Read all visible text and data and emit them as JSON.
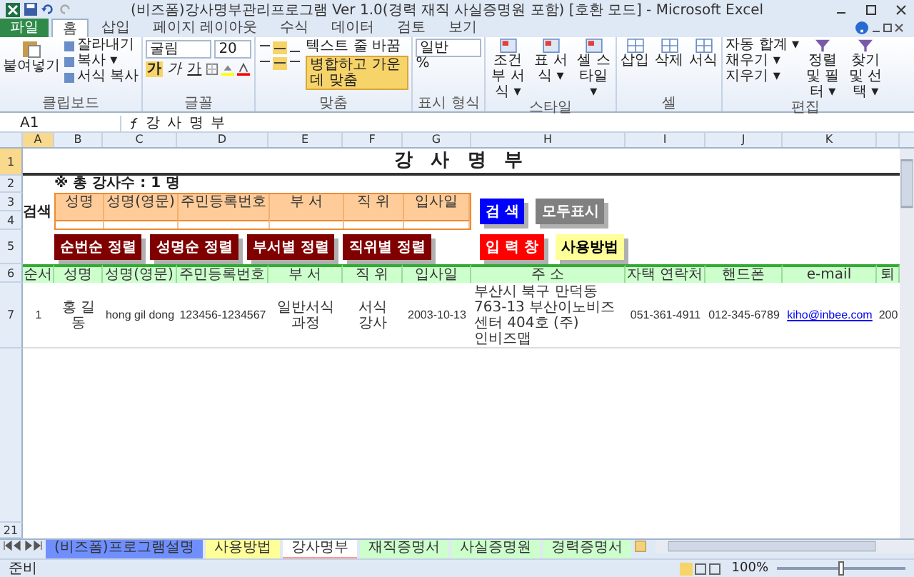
{
  "window": {
    "title": "(비즈폼)강사명부관리프로그램 Ver 1.0(경력 재직 사실증명원 포함) [호환 모드] - Microsoft Excel"
  },
  "ribbon_tabs": [
    {
      "label": "파일",
      "selected": false,
      "kind": "file"
    },
    {
      "label": "홈",
      "selected": true,
      "kind": "tab"
    },
    {
      "label": "삽입",
      "selected": false,
      "kind": "tab"
    },
    {
      "label": "페이지 레이아웃",
      "selected": false,
      "kind": "tab"
    },
    {
      "label": "수식",
      "selected": false,
      "kind": "tab"
    },
    {
      "label": "데이터",
      "selected": false,
      "kind": "tab"
    },
    {
      "label": "검토",
      "selected": false,
      "kind": "tab"
    },
    {
      "label": "보기",
      "selected": false,
      "kind": "tab"
    }
  ],
  "ribbon": {
    "clipboard": {
      "label": "클립보드",
      "paste": "붙여넣기",
      "commands": [
        "잘라내기",
        "복사 ▾",
        "서식 복사"
      ]
    },
    "font": {
      "label": "글꼴",
      "family": "굴림",
      "size": "20",
      "styles": [
        "가",
        "가",
        "가"
      ]
    },
    "alignment": {
      "label": "맞춤",
      "commands": [
        "텍스트 줄 바꿈",
        "병합하고 가운데 맞춤"
      ]
    },
    "number": {
      "label": "표시 형식",
      "format": "일반",
      "percent": "%"
    },
    "styles": {
      "label": "스타일",
      "commands": [
        "조건부 서식 ▾",
        "표 서식 ▾",
        "셀 스타일 ▾"
      ]
    },
    "cells": {
      "label": "셀",
      "commands": [
        "삽입",
        "삭제",
        "서식"
      ]
    },
    "editing": {
      "label": "편집",
      "commands": [
        "자동 합계 ▾",
        "채우기 ▾",
        "지우기 ▾"
      ],
      "big": [
        "정렬 및 필터 ▾",
        "찾기 및 선택 ▾"
      ]
    }
  },
  "formula_bar": {
    "name_box": "A1",
    "formula": "강 사 명 부"
  },
  "columns": [
    "A",
    "B",
    "C",
    "D",
    "E",
    "F",
    "G",
    "H",
    "I",
    "J",
    "K"
  ],
  "row_numbers": [
    "1",
    "2",
    "3",
    "4",
    "5",
    "6",
    "7",
    "21"
  ],
  "sheet": {
    "title": "강 사 명 부",
    "count": "※ 총 강사수 : 1 명",
    "search_label": "검색",
    "search_headers": [
      "성명",
      "성명(영문)",
      "주민등록번호",
      "부 서",
      "직 위",
      "입사일"
    ],
    "search_buttons": [
      {
        "label": "검 색",
        "color": "#0000ff"
      },
      {
        "label": "모두표시",
        "color": "#808080"
      }
    ],
    "sort_buttons": [
      "순번순 정렬",
      "성명순 정렬",
      "부서별 정렬",
      "직위별 정렬"
    ],
    "action_buttons": [
      {
        "label": "입 력 창",
        "color": "#ff0000"
      },
      {
        "label": "사용방법",
        "color": "#ffff99"
      }
    ],
    "table_headers": [
      "순서",
      "성명",
      "성명(영문)",
      "주민등록번호",
      "부 서",
      "직 위",
      "입사일",
      "주 소",
      "자택 연락처",
      "핸드폰",
      "e-mail",
      "퇴"
    ],
    "rows": [
      {
        "cells": [
          "1",
          "홍 길 동",
          "hong gil dong",
          "123456-1234567",
          "일반서식 과정",
          "서식 강사",
          "2003-10-13",
          "부산시 북구 만덕동 763-13 부산이노비즈 센터 404호 (주)인비즈맵",
          "051-361-4911",
          "012-345-6789",
          "kiho@inbee.com",
          "200"
        ]
      }
    ]
  },
  "sheet_tabs": [
    {
      "label": "(비즈폼)프로그램설명",
      "selected": false,
      "color": "#6f8fff"
    },
    {
      "label": "사용방법",
      "selected": false,
      "color": "#ffff99"
    },
    {
      "label": "강사명부",
      "selected": true,
      "color": "#ff9999"
    },
    {
      "label": "재직증명서",
      "selected": false,
      "color": "#ccffcc"
    },
    {
      "label": "사실증명원",
      "selected": false,
      "color": "#ccffcc"
    },
    {
      "label": "경력증명서",
      "selected": false,
      "color": "#ccffcc"
    }
  ],
  "status_bar": {
    "mode": "준비",
    "zoom": "100%",
    "zoom_slider": {
      "level": 0.5
    }
  }
}
